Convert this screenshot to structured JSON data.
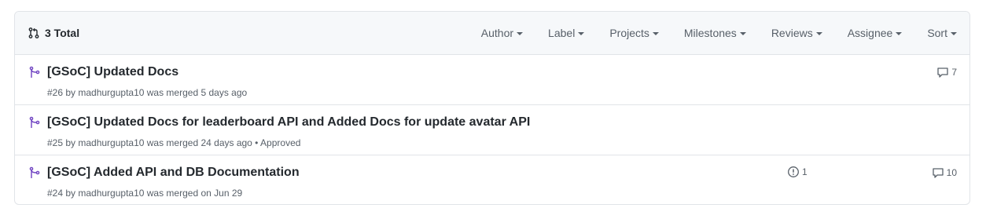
{
  "header": {
    "total_label": "3 Total",
    "filters": [
      "Author",
      "Label",
      "Projects",
      "Milestones",
      "Reviews",
      "Assignee",
      "Sort"
    ]
  },
  "pull_requests": [
    {
      "title": "[GSoC] Updated Docs",
      "meta": "#26 by madhurgupta10 was merged 5 days ago",
      "comments": "7"
    },
    {
      "title": "[GSoC] Updated Docs for leaderboard API and Added Docs for update avatar API",
      "meta": "#25 by madhurgupta10 was merged 24 days ago • Approved"
    },
    {
      "title": "[GSoC] Added API and DB Documentation",
      "meta": "#24 by madhurgupta10 was merged on Jun 29",
      "linked_issues": "1",
      "comments": "10"
    }
  ],
  "colors": {
    "merged_purple": "#6f42c1",
    "header_bg": "#f6f8fa",
    "border": "#e1e4e8",
    "muted_text": "#586069"
  },
  "icons": {
    "total": "git-pull-request-icon",
    "row": "git-merge-icon",
    "comments": "comment-icon",
    "issues": "issue-opened-icon"
  }
}
